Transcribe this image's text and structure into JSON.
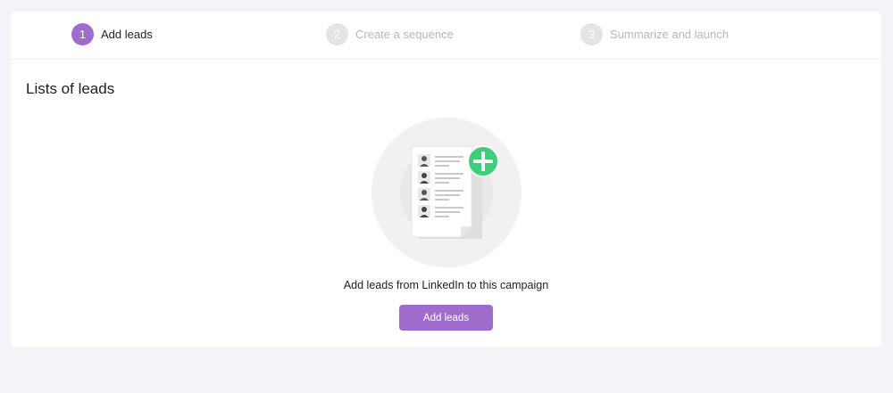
{
  "stepper": {
    "steps": [
      {
        "number": "1",
        "label": "Add leads",
        "state": "active"
      },
      {
        "number": "2",
        "label": "Create a sequence",
        "state": "inactive"
      },
      {
        "number": "3",
        "label": "Summarize and launch",
        "state": "inactive"
      }
    ]
  },
  "main": {
    "title": "Lists of leads",
    "empty_state": {
      "illustration_icon": "lead-list-add-icon",
      "message": "Add leads from LinkedIn to this campaign",
      "button_label": "Add leads"
    }
  },
  "colors": {
    "accent": "#a06ccc",
    "plus_badge": "#3fcf7c",
    "background": "#f3f4f8"
  }
}
